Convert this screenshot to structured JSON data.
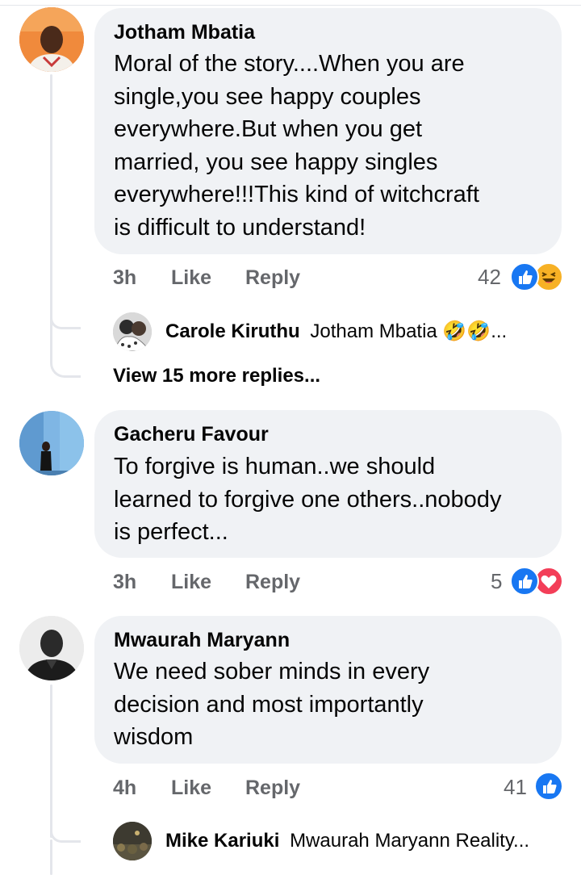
{
  "comments": [
    {
      "author": "Jotham Mbatia",
      "text": "Moral of the story....When you are\nsingle,you see happy couples\neverywhere.But when you get\nmarried, you see happy singles\neverywhere!!!This kind of witchcraft\nis difficult to understand!",
      "time": "3h",
      "like_label": "Like",
      "reply_label": "Reply",
      "reaction_count": "42",
      "reactions": [
        "like-icon",
        "haha-icon"
      ],
      "reply_preview": {
        "author": "Carole Kiruthu",
        "text": "Jotham Mbatia 🤣🤣..."
      },
      "view_more": "View 15 more replies..."
    },
    {
      "author": "Gacheru Favour",
      "text": "To forgive is human..we should\nlearned to forgive one others..nobody\nis perfect...",
      "time": "3h",
      "like_label": "Like",
      "reply_label": "Reply",
      "reaction_count": "5",
      "reactions": [
        "like-icon",
        "love-icon"
      ]
    },
    {
      "author": "Mwaurah Maryann",
      "text": "We need sober minds in every\ndecision and most importantly\nwisdom",
      "time": "4h",
      "like_label": "Like",
      "reply_label": "Reply",
      "reaction_count": "41",
      "reactions": [
        "like-icon"
      ],
      "reply_preview": {
        "author": "Mike Kariuki",
        "text": "Mwaurah Maryann Reality..."
      }
    }
  ],
  "colors": {
    "bubble": "#f0f2f5",
    "meta": "#65676b",
    "like": "#1877f2",
    "love": "#f33e58",
    "haha": "#f7b125"
  }
}
